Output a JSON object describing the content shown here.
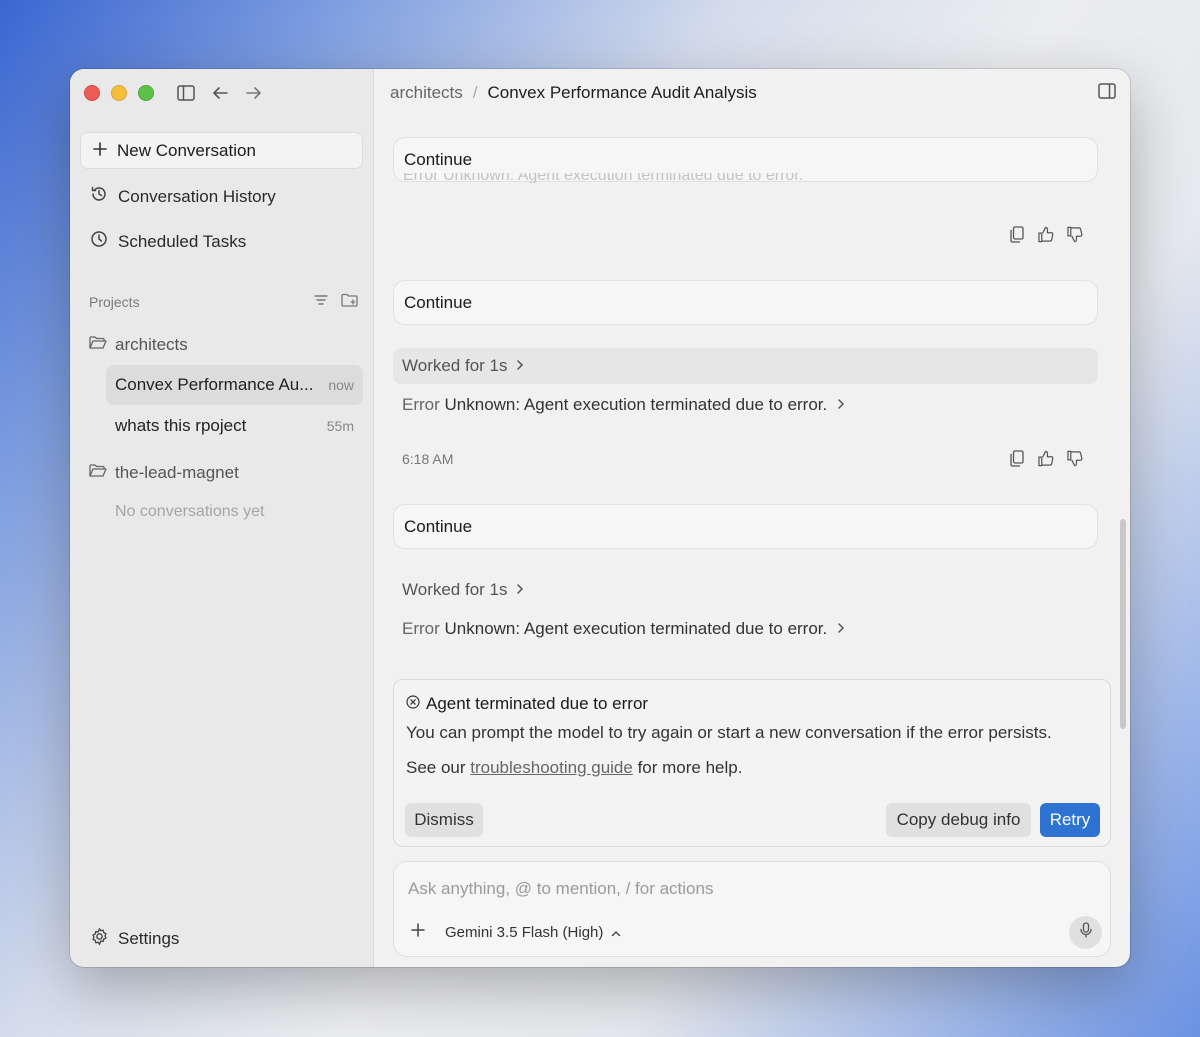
{
  "sidebar": {
    "new_conversation": "New Conversation",
    "conversation_history": "Conversation History",
    "scheduled_tasks": "Scheduled Tasks",
    "projects_label": "Projects",
    "folders": [
      {
        "name": "architects"
      },
      {
        "name": "the-lead-magnet"
      }
    ],
    "conversations": [
      {
        "title": "Convex Performance Au...",
        "time": "now"
      },
      {
        "title": "whats this rpoject",
        "time": "55m"
      }
    ],
    "empty_text": "No conversations yet",
    "settings": "Settings"
  },
  "header": {
    "project": "architects",
    "separator": "/",
    "title": "Convex Performance Audit Analysis"
  },
  "messages": {
    "continue": "Continue",
    "faded_error": "Error Unknown: Agent execution terminated due to error.",
    "worked": "Worked for 1s",
    "error_label": "Error",
    "error_text": "Unknown: Agent execution terminated due to error.",
    "timestamp": "6:18 AM"
  },
  "error_card": {
    "title": "Agent terminated due to error",
    "body": "You can prompt the model to try again or start a new conversation if the error persists.",
    "help_prefix": "See our ",
    "help_link": "troubleshooting guide",
    "help_suffix": " for more help.",
    "dismiss": "Dismiss",
    "copy_debug": "Copy debug info",
    "retry": "Retry"
  },
  "composer": {
    "placeholder": "Ask anything, @ to mention, / for actions",
    "model": "Gemini 3.5 Flash (High)"
  },
  "colors": {
    "accent": "#2e73d2",
    "close": "#ee5c56",
    "minimize": "#f5bd3b",
    "maximize": "#5dc148"
  }
}
